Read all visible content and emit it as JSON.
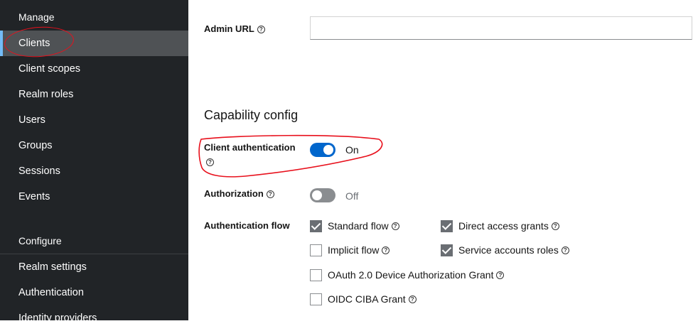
{
  "sidebar": {
    "manage_title": "Manage",
    "manage_items": [
      {
        "label": "Clients"
      },
      {
        "label": "Client scopes"
      },
      {
        "label": "Realm roles"
      },
      {
        "label": "Users"
      },
      {
        "label": "Groups"
      },
      {
        "label": "Sessions"
      },
      {
        "label": "Events"
      }
    ],
    "configure_title": "Configure",
    "configure_items": [
      {
        "label": "Realm settings"
      },
      {
        "label": "Authentication"
      },
      {
        "label": "Identity providers"
      }
    ],
    "active_item": "Clients"
  },
  "form": {
    "admin_url": {
      "label": "Admin URL",
      "value": ""
    },
    "capability_heading": "Capability config",
    "client_auth": {
      "label": "Client authentication",
      "state": "On",
      "enabled": true
    },
    "authorization": {
      "label": "Authorization",
      "state": "Off",
      "enabled": false
    },
    "auth_flow": {
      "label": "Authentication flow",
      "options": [
        {
          "label": "Standard flow",
          "checked": true
        },
        {
          "label": "Direct access grants",
          "checked": true
        },
        {
          "label": "Implicit flow",
          "checked": false
        },
        {
          "label": "Service accounts roles",
          "checked": true
        },
        {
          "label": "OAuth 2.0 Device Authorization Grant",
          "checked": false
        },
        {
          "label": "OIDC CIBA Grant",
          "checked": false
        }
      ]
    }
  },
  "icons": {
    "help": "?"
  },
  "colors": {
    "sidebar_bg": "#212427",
    "active_bg": "#4f5255",
    "switch_on": "#0066cc",
    "switch_off": "#8a8d90",
    "annotation": "#e8101c"
  }
}
